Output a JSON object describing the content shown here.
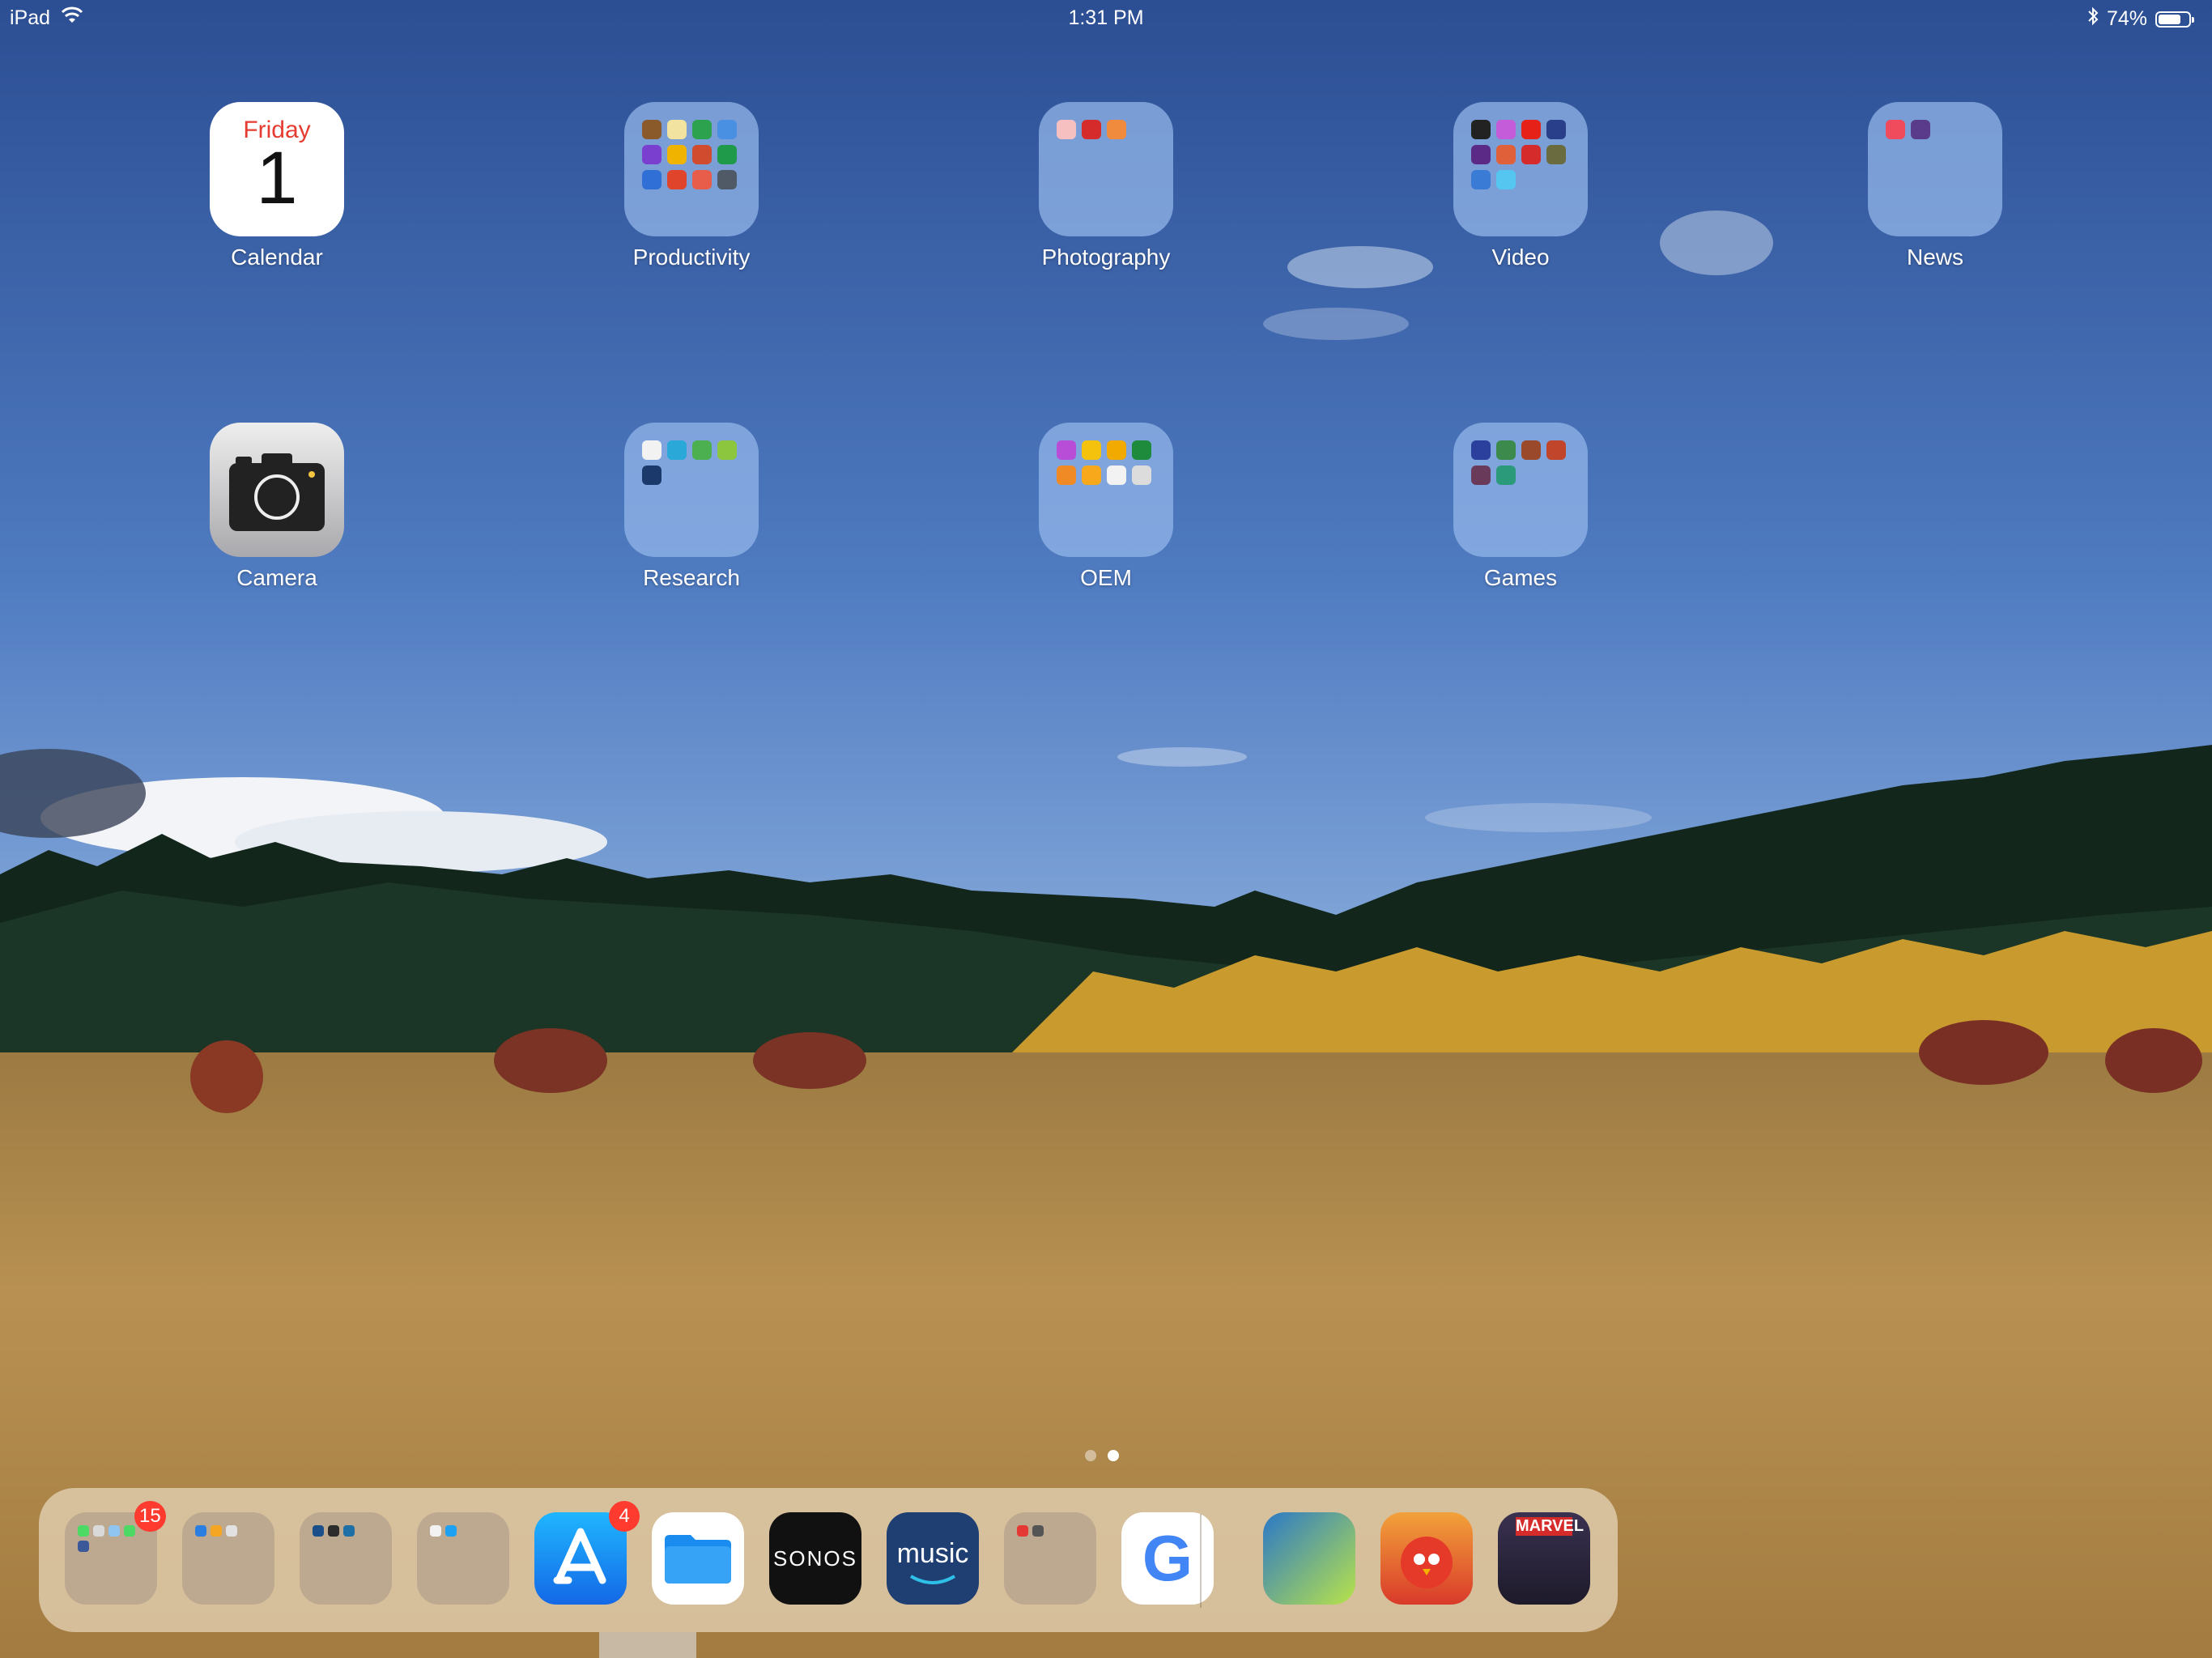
{
  "status_bar": {
    "device": "iPad",
    "time": "1:31 PM",
    "battery": "74%",
    "battery_level": 0.74
  },
  "apps": [
    {
      "name": "Calendar",
      "kind": "calendar",
      "weekday": "Friday",
      "date": "1"
    },
    {
      "name": "Productivity",
      "kind": "folder",
      "icons": [
        "#8b5a2b",
        "#f3e3a0",
        "#2ca24f",
        "#4a90e2",
        "#7b3fd0",
        "#f0b400",
        "#d14b2f",
        "#1f9a4b",
        "#2f6fd6",
        "#e0442b",
        "#e85d4a",
        "#505a66"
      ]
    },
    {
      "name": "Photography",
      "kind": "folder",
      "icons": [
        "#f7c0c0",
        "#d62b2b",
        "#f08a3c"
      ]
    },
    {
      "name": "Video",
      "kind": "folder",
      "icons": [
        "#222",
        "#c45bd8",
        "#e62117",
        "#2a3f8a",
        "#5b2a86",
        "#e0603a",
        "#d62b2b",
        "#6b6b40",
        "#3a7bd5",
        "#55c6f0"
      ]
    },
    {
      "name": "News",
      "kind": "folder",
      "icons": [
        "#f04b5c",
        "#5a3a8a"
      ]
    },
    {
      "name": "Camera",
      "kind": "camera"
    },
    {
      "name": "Research",
      "kind": "folder",
      "icons": [
        "#f2f2f2",
        "#2aa8d8",
        "#4caf50",
        "#8cc63f",
        "#1b3a6b"
      ]
    },
    {
      "name": "OEM",
      "kind": "folder",
      "icons": [
        "#b84ed8",
        "#f4c20d",
        "#f2a900",
        "#1e8a3b",
        "#f08a24",
        "#f7a91b",
        "#f2f2f2",
        "#dcdcdc"
      ]
    },
    {
      "name": "Games",
      "kind": "folder",
      "icons": [
        "#2b3f9c",
        "#3c8a4c",
        "#9a4a2a",
        "#c0452a",
        "#6a3a5a",
        "#2a9a7a"
      ]
    }
  ],
  "page_indicator": {
    "count": 2,
    "active": 2
  },
  "dock": {
    "items": [
      {
        "kind": "folder",
        "name": "dock-folder-1",
        "badge": "15",
        "icons": [
          "#4cd964",
          "#d9d9d9",
          "#8fc5f0",
          "#4cd964",
          "#3b5998"
        ]
      },
      {
        "kind": "folder",
        "name": "dock-folder-2",
        "icons": [
          "#2a7de1",
          "#f5a623",
          "#e1e1e1"
        ]
      },
      {
        "kind": "folder",
        "name": "dock-folder-3",
        "icons": [
          "#1b4f8a",
          "#2c2c2c",
          "#1d6fa5"
        ]
      },
      {
        "kind": "folder",
        "name": "dock-folder-4",
        "icons": [
          "#f2f2f2",
          "#1da1f2"
        ]
      },
      {
        "kind": "app",
        "name": "App Store",
        "badge": "4",
        "color": "#1e8ef2"
      },
      {
        "kind": "app",
        "name": "Files",
        "color": "#ffffff"
      },
      {
        "kind": "app",
        "name": "Sonos",
        "label": "SONOS",
        "color": "#111111"
      },
      {
        "kind": "app",
        "name": "Amazon Music",
        "label": "music",
        "color": "#1f3f73"
      },
      {
        "kind": "folder",
        "name": "dock-folder-5",
        "icons": [
          "#e53935",
          "#555555"
        ]
      },
      {
        "kind": "app",
        "name": "Google",
        "label": "G",
        "color": "#ffffff"
      }
    ],
    "recent": [
      {
        "name": "Game 1",
        "color": "#2a78c8"
      },
      {
        "name": "Angry Birds",
        "color": "#d93a2a"
      },
      {
        "name": "Marvel",
        "label": "MARVEL",
        "color": "#1d1a2a"
      }
    ]
  }
}
